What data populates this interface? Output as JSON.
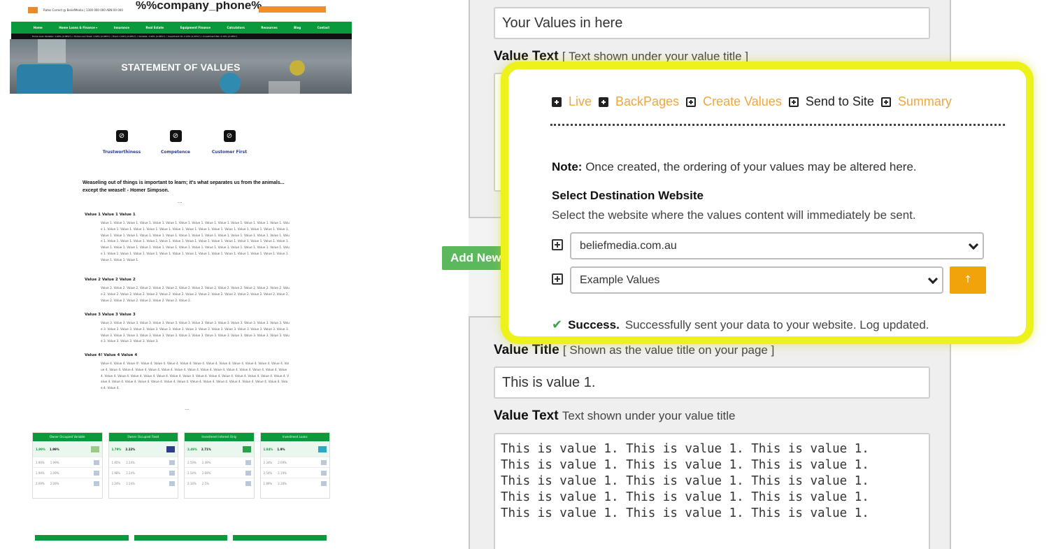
{
  "site": {
    "topbar_small": "Rates Correct @ BeliefMedia | 1300 000 000 ABN 00 000",
    "phone_placeholder": "%%company_phone%",
    "nav": [
      "Home",
      "Home Loans & Finance ▾",
      "Insurance",
      "Real Estate",
      "Equipment Finance",
      "Calculators",
      "Resources",
      "Blog",
      "Contact"
    ],
    "ticker": "Home Loan Variable: 1.99% (2.08%*) • Home Loan Fixed: 1.99% (2.08%*) • Fixed: 1.99% (2.08%*) • Variable: 1.99% (2.08%*) • Investment IO: 2.19% (2.25%*) • Investment P&I: 2.19% (2.28%*)",
    "hero_title": "STATEMENT OF VALUES",
    "icons": [
      {
        "label": "Trustworthiness",
        "icon": "check-circle-icon"
      },
      {
        "label": "Competence",
        "icon": "check-circle-icon"
      },
      {
        "label": "Customer First",
        "icon": "check-circle-icon"
      }
    ],
    "quote": "Weaseling out of things is important to learn; it's what separates us from the animals... except the weasel! - Homer Simpson.",
    "ellipsis": "...",
    "values": [
      {
        "title": "Value 1 Value 1 Value 1",
        "body": "Value 1. Value 1. Value 1. Value 1. Value 1. Value 1. Value 1. Value 1. Value 1. Value 1. Value 1. Value 1. Value 1. Value 1. Value 1. Value 1. Value 1. Value 1. Value 1. Value 1. Value 1. Value 1. Value 1. Value 1. Value 1. Value 1. Value 1. Value 1. Value 1. Value 1. Value 1. Value 1. Value 1. Value 1. Value 1. Value 1. Value 1. Value 1. Value 1. Value 1. Value 1. Value 1. Value 1. Value 1. Value 1. Value 1. Value 1. Value 1. Value 1. Value 1. Value 1. Value 1. Value 1. Value 1. Value 1. Value 1. Value 1. Value 1. Value 1. Value 1. Value 1. Value 1. Value 1. Value 1. Value 1. Value 1. Value 1. Value 1. Value 1. Value 1. Value 1. Value 1. Value 1. Value 1. Value 1. Value 1. Value 1. Value 1. Value 1. Value 1. Value 1. Value 1. Value 1. Value 1. Value 1. Value 1. Value 1. Value 1. Value 1. Value 1."
      },
      {
        "title": "Value 2 Value 2 Value 2",
        "body": "Value 2. Value 2. Value 2. Value 2. Value 2. Value 2. Value 2. Value 2. Value 2. Value 2. Value 2. Value 2. Value 2. Value 2. Value 2. Value 2. Value 2. Value 2. Value 2. Value 2. Value 2. Value 2. Value 2. Value 2. Value 2. Value 2. Value 2. Value 2. Value 2. Value 2. Value 2. Value 2. Value 2. Value 2. Value 2. Value 2."
      },
      {
        "title": "Value 3 Value 3 Value 3",
        "body": "Value 3. Value 3. Value 3. Value 3. Value 3. Value 3. Value 3. Value 3. Value 3. Value 3. Value 3. Value 3. Value 3. Value 3. Value 3. Value 3. Value 3. Value 3. Value 3. Value 3. Value 3. Value 3. Value 3. Value 3. Value 3. Value 3. Value 3. Value 3. Value 3. Value 3. Value 3. Value 3. Value 3. Value 3. Value 3. Value 3. Value 3. Value 3. Value 3. Value 3. Value 3. Value 3. Value 3. Value 3. Value 3. Value 3. Value 3. Value 3."
      },
      {
        "title": "Value 4! Value 4 Value 4",
        "body": "Value 4. Value 4. Value 4!. Value 4. Value 4. Value 4. Value 4. Value 4. Value 4. Value 4. Value 4. Value 4. Value 4. Value 4. Value 4. Value 4. Value 4. Value 4. Value 4. Value 4. Value 4. Value 4. Value 4. Value 4. Value 4. Value 4. Value 4. Value 4. Value 4. Value 4. Value 4. Value 4. Value 4. Value 4. Value 4. Value 4. Value 4. Value 4. Value 4. Value 4. Value 4. Value 4. Value 4. Value 4. Value 4. Value 4. Value 4. Value 4. Value 4. Value 4. Value 4. Value 4. Value 4. Value 4. Value 4. Value 4. Value 4. Value 4. Value 4."
      }
    ],
    "rate_cards": [
      {
        "title": "Owner Occupied Variable",
        "rate": "1.99%",
        "comparison": "1.99%",
        "rows": [
          [
            "1.99%",
            "1.99%"
          ],
          [
            "1.99%",
            "2.09%"
          ],
          [
            "2.09%",
            "2.09%"
          ]
        ]
      },
      {
        "title": "Owner Occupied Fixed",
        "rate": "1.79%",
        "comparison": "2.22%",
        "rows": [
          [
            "1.85%",
            "2.24%"
          ],
          [
            "1.98%",
            "2.24%"
          ],
          [
            "2.24%",
            "2.24%"
          ]
        ]
      },
      {
        "title": "Investment Interest Only",
        "rate": "2.49%",
        "comparison": "2.71%",
        "rows": [
          [
            "2.59%",
            "2.49%"
          ],
          [
            "2.54%",
            "2.69%"
          ],
          [
            "2.34%",
            "2.5%"
          ]
        ]
      },
      {
        "title": "Investment Loans",
        "rate": "1.84%",
        "comparison": "1.9%",
        "rows": [
          [
            "2.34%",
            "2.09%"
          ],
          [
            "2.54%",
            "2.19%"
          ],
          [
            "1.89%",
            "2.28%"
          ]
        ]
      }
    ]
  },
  "form": {
    "values_title_input": "Your Values in here",
    "value_text_label_top": "Value Text",
    "value_text_hint_top": "[ Text shown under your value title ]",
    "add_new_button": "Add New",
    "value_title_label": "Value Title",
    "value_title_hint": "[ Shown as the value title on your page ]",
    "value_title_input": "This is value 1.",
    "value_text_label": "Value Text",
    "value_text_hint": "Text shown under your value title",
    "value_text_area": "This is value 1. This is value 1. This is value 1.\nThis is value 1. This is value 1. This is value 1.\nThis is value 1. This is value 1. This is value 1.\nThis is value 1. This is value 1. This is value 1.\nThis is value 1. This is value 1. This is value 1."
  },
  "callout": {
    "tabs": [
      {
        "label": "Live",
        "icon": "minus-box-icon",
        "active": false
      },
      {
        "label": "BackPages",
        "icon": "minus-box-icon",
        "active": false
      },
      {
        "label": "Create Values",
        "icon": "plus-box-icon",
        "active": false
      },
      {
        "label": "Send to Site",
        "icon": "plus-box-icon",
        "active": true
      },
      {
        "label": "Summary",
        "icon": "plus-box-icon",
        "active": false
      }
    ],
    "note_label": "Note:",
    "note_text": "Once created, the ordering of your values may be altered here.",
    "dest_title": "Select Destination Website",
    "dest_desc": "Select the website where the values content will immediately be sent.",
    "website_select": "beliefmedia.com.au",
    "values_select": "Example Values",
    "go_button": "↑",
    "success_label": "Success.",
    "success_text": "Successfully sent your data to your website. Log updated."
  },
  "colors": {
    "brand_green": "#0a9a3c",
    "highlight_yellow": "#ecf21a",
    "accent_orange": "#f0a30a",
    "add_button_green": "#5cb85c"
  }
}
